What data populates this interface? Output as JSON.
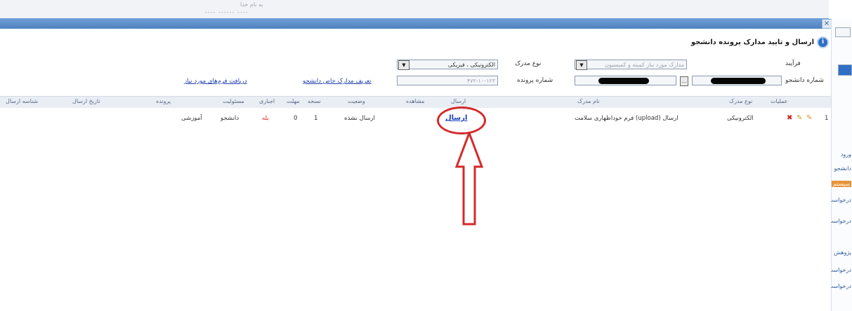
{
  "window": {
    "top_faint_text": "به نام خدا",
    "close_label": "×"
  },
  "dialog": {
    "title": "ارسال و تایید مدارک پرونده دانشجو",
    "info_icon": "i"
  },
  "form": {
    "process_label": "فرآیند",
    "process_value": "مدارک مورد نیاز کمیته و کمیسیون",
    "doc_type_label": "نوع مدرک",
    "doc_type_value": "الکترونیکی ، فیزیکی",
    "student_no_label": "شماره دانشجو",
    "file_no_label": "شماره پرونده",
    "file_no_value": "۴۷۲-۱۰-۱۲۳",
    "links": {
      "define_docs": "تعریف مدارک خاص دانشجو",
      "receive_forms": "دریافت فرم‌های مورد نیاز"
    }
  },
  "table": {
    "headers": {
      "actions": "عملیات",
      "doc_type": "نوع مدرک",
      "doc_name": "نام مدرک",
      "send": "ارسال",
      "view": "مشاهده",
      "status": "وضعیت",
      "copy_count": "نسخه",
      "deadline": "مهلت",
      "mandatory": "اجباری",
      "responsibility": "مسئولیت",
      "file": "پرونده",
      "send_date": "تاریخ ارسال",
      "send_id": "شناسه ارسال"
    },
    "rows": [
      {
        "index": "1",
        "doc_type": "الکترونیکی",
        "doc_name": "ارسال (upload) فرم خوداظهاری سلامت",
        "send": "ارسال",
        "status": "ارسال نشده",
        "copy_count": "1",
        "deadline": "0",
        "mandatory": "بله",
        "responsibility": "دانشجو",
        "file": "آموزشی"
      }
    ]
  },
  "side_panel": {
    "items": [
      "ورود",
      "دانشجو",
      "سیستم",
      "درخواست",
      "درخواست",
      "پژوهش",
      "درخواست",
      "درخواست"
    ]
  },
  "colors": {
    "accent_red": "#d42a2a",
    "title_bar": "#5a8bc6",
    "link_blue": "#1a3dbf"
  }
}
